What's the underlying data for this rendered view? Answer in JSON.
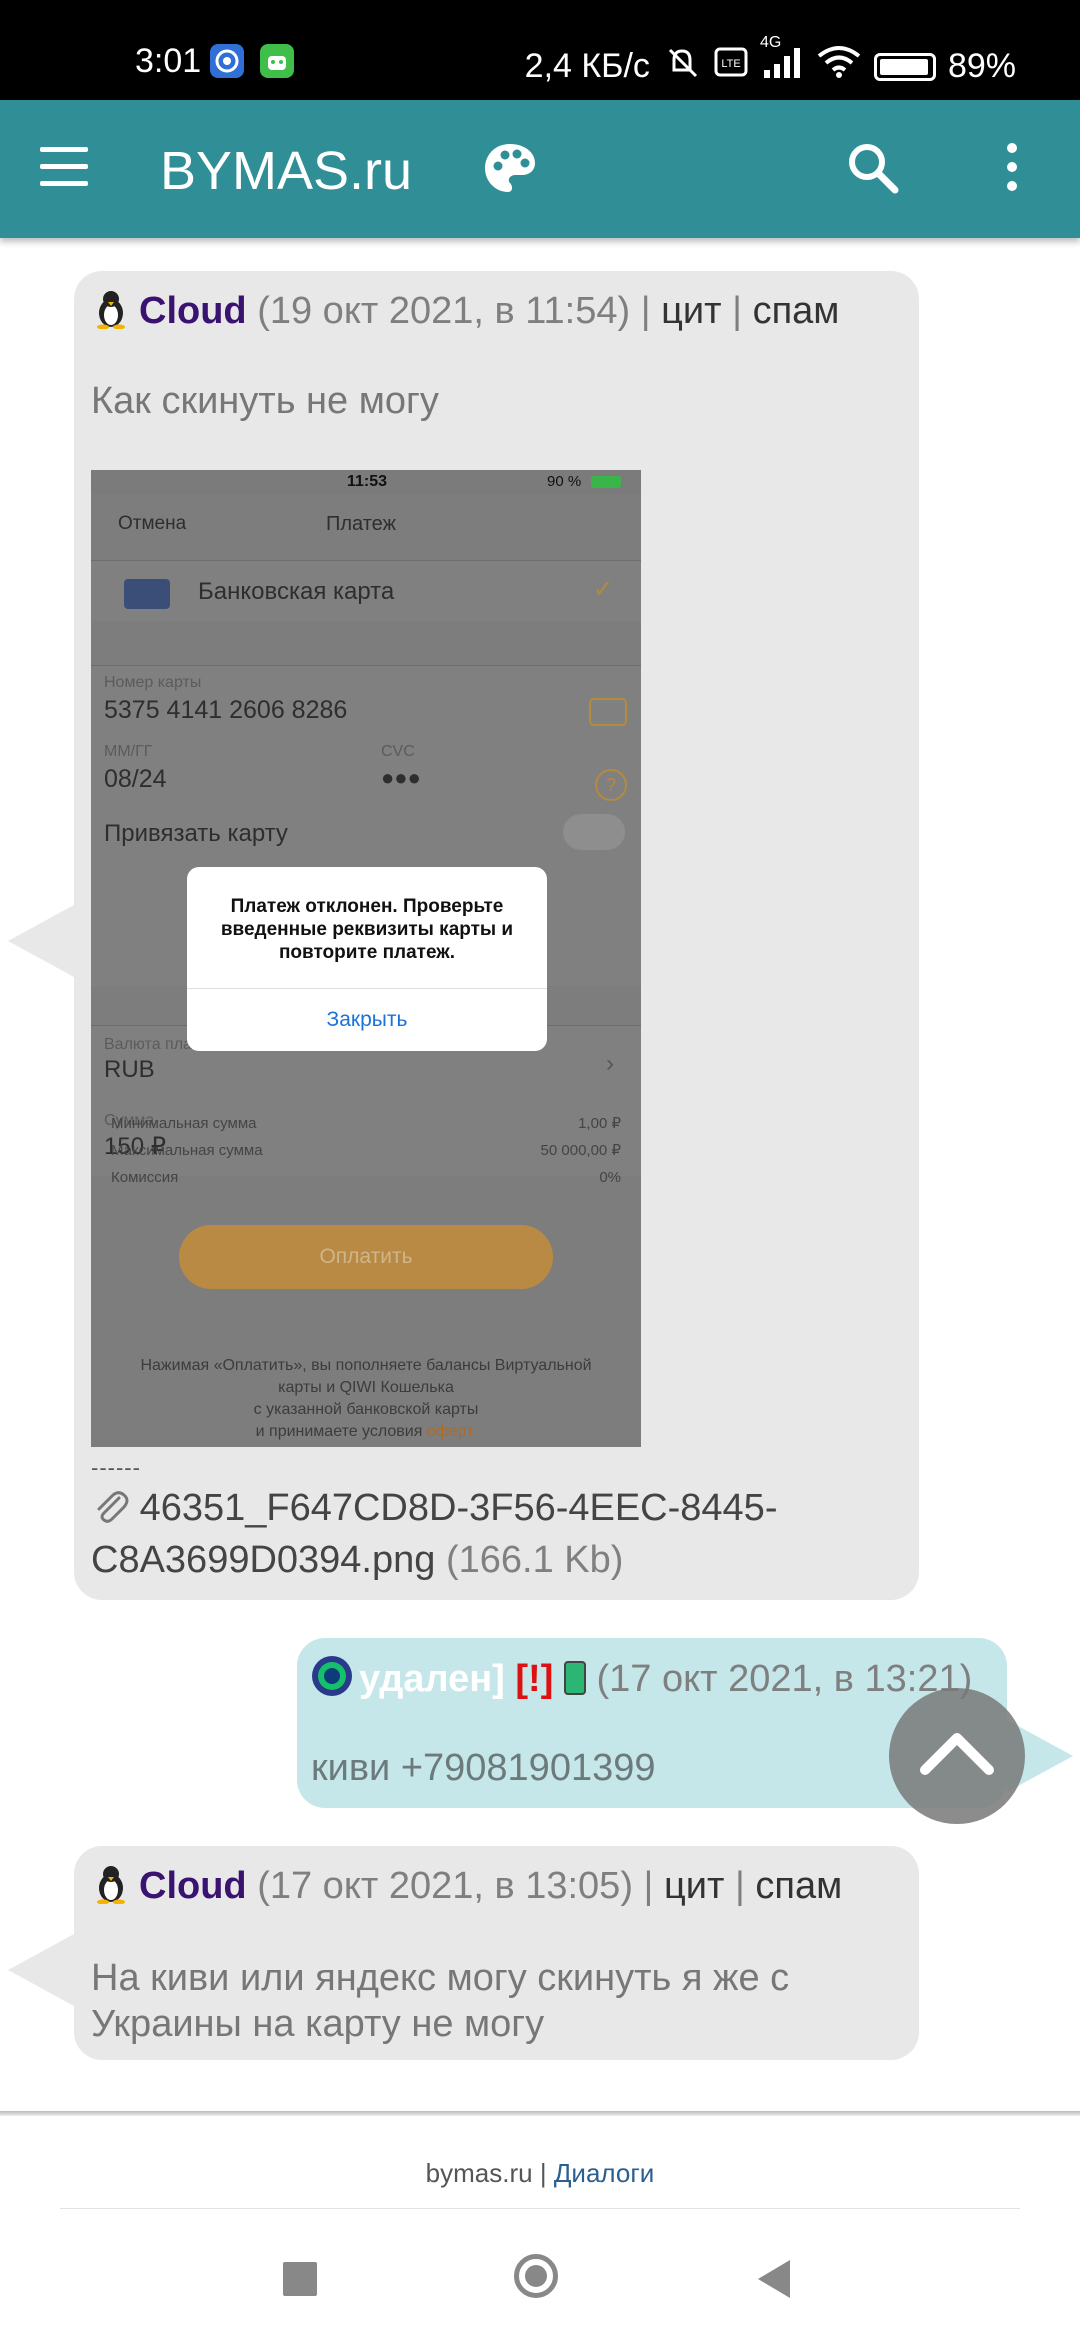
{
  "status_bar": {
    "time": "3:01",
    "net_speed": "2,4 КБ/с",
    "signal_label": "4G",
    "battery": "89%"
  },
  "app_bar": {
    "title": "BYMAS.ru",
    "icons": [
      "menu-icon",
      "palette-icon",
      "search-icon",
      "more-vert-icon"
    ],
    "color": "#2f8e96"
  },
  "messages": [
    {
      "user": "Cloud",
      "date": "(19 окт 2021, в 11:54)",
      "sep": "|",
      "quote": "цит",
      "spam": "спам",
      "text": "Как скинуть не могу",
      "screenshot": {
        "time": "11:53",
        "battery": "90 %",
        "cancel": "Отмена",
        "header": "Платеж",
        "card_type": "Банковская карта",
        "card_number_label": "Номер карты",
        "card_number": "5375 4141 2606 8286",
        "exp_label": "ММ/ГГ",
        "exp": "08/24",
        "cvc_label": "CVC",
        "cvc": "●●●",
        "bind_card": "Привязать карту",
        "currency_label": "Валюта пла",
        "currency": "RUB",
        "sum_label": "Сумма",
        "sum": "150 ₽",
        "min_label": "Минимальная сумма",
        "min_value": "1,00 ₽",
        "max_label": "Максимальная сумма",
        "max_value": "50 000,00 ₽",
        "fee_label": "Комиссия",
        "fee_value": "0%",
        "pay_button": "Оплатить",
        "footer_line1": "Нажимая «Оплатить», вы пополняете балансы Виртуальной",
        "footer_line2": "карты и QIWI Кошелька",
        "footer_line3": "с указанной банковской карты",
        "footer_line4": "и принимаете условия",
        "footer_link": "оферт.",
        "dialog_text": "Платеж отклонен. Проверьте введенные реквизиты карты и повторите платеж.",
        "dialog_button": "Закрыть"
      },
      "divider": "------",
      "attachment_name": "46351_F647CD8D-3F56-4EEC-8445-C8A3699D0394.png",
      "attachment_size": "(166.1 Kb)"
    },
    {
      "user": "удален]",
      "flag": "[!]",
      "date": "(17 окт 2021, в 13:21)",
      "text": "киви +79081901399"
    },
    {
      "user": "Cloud",
      "date": "(17 окт 2021, в 13:05)",
      "sep": "|",
      "quote": "цит",
      "spam": "спам",
      "text": "На киви или яндекс могу скинуть я же с Украины на карту не могу"
    }
  ],
  "footer": {
    "site": "bymas.ru",
    "sep": "|",
    "link": "Диалоги"
  }
}
